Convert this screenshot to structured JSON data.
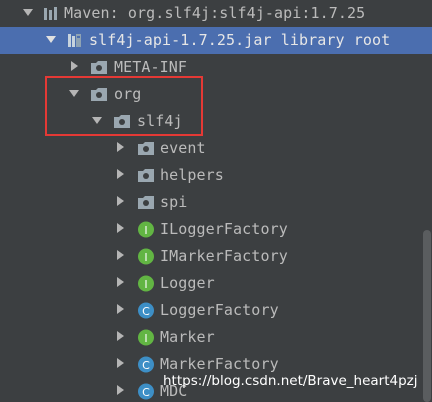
{
  "tree": {
    "maven_lib": {
      "label": "Maven: org.slf4j:slf4j-api:1.7.25",
      "expanded": true,
      "icon": "library-bars-icon"
    },
    "jar": {
      "label": "slf4j-api-1.7.25.jar library root",
      "expanded": true,
      "icon": "jar-icon",
      "selected": true
    },
    "meta_inf": {
      "label": "META-INF",
      "expanded": false,
      "icon": "package-folder-icon"
    },
    "org": {
      "label": "org",
      "expanded": true,
      "icon": "package-folder-icon"
    },
    "slf4j": {
      "label": "slf4j",
      "expanded": true,
      "icon": "package-folder-icon"
    },
    "children": [
      {
        "label": "event",
        "kind": "package",
        "icon": "package-folder-icon"
      },
      {
        "label": "helpers",
        "kind": "package",
        "icon": "package-folder-icon"
      },
      {
        "label": "spi",
        "kind": "package",
        "icon": "package-folder-icon"
      },
      {
        "label": "ILoggerFactory",
        "kind": "interface",
        "icon": "interface-icon",
        "badge": "I"
      },
      {
        "label": "IMarkerFactory",
        "kind": "interface",
        "icon": "interface-icon",
        "badge": "I"
      },
      {
        "label": "Logger",
        "kind": "interface",
        "icon": "interface-icon",
        "badge": "I"
      },
      {
        "label": "LoggerFactory",
        "kind": "class",
        "icon": "class-icon",
        "badge": "C"
      },
      {
        "label": "Marker",
        "kind": "interface",
        "icon": "interface-icon",
        "badge": "I"
      },
      {
        "label": "MarkerFactory",
        "kind": "class",
        "icon": "class-icon",
        "badge": "C"
      },
      {
        "label": "MDC",
        "kind": "class",
        "icon": "class-icon",
        "badge": "C"
      }
    ]
  },
  "watermark": "https://blog.csdn.net/Brave_heart4pzj",
  "colors": {
    "background": "#3c3f41",
    "selection": "#4b6eaf",
    "text": "#bbbbbb",
    "highlight_box": "#e53935",
    "interface_badge": "#62b543",
    "class_badge": "#3d8fc6"
  }
}
